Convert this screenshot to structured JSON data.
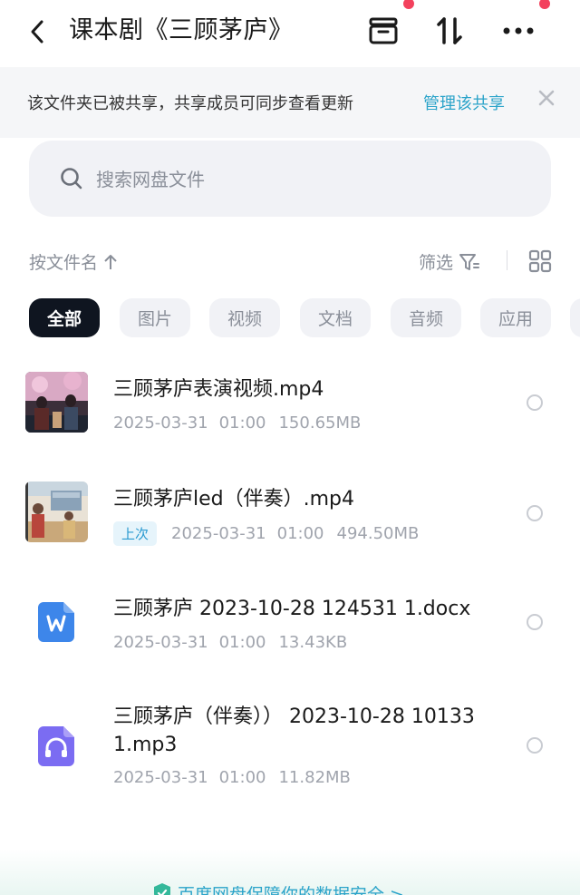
{
  "header": {
    "title": "课本剧《三顾茅庐》",
    "icons": [
      "back-icon",
      "archive-icon",
      "sort-icon",
      "more-icon"
    ]
  },
  "share_banner": {
    "text": "该文件夹已被共享，共享成员可同步查看更新",
    "link": "管理该共享"
  },
  "search": {
    "placeholder": "搜索网盘文件"
  },
  "toolbar": {
    "sort_label": "按文件名",
    "filter_label": "筛选"
  },
  "chips": [
    "全部",
    "图片",
    "视频",
    "文档",
    "音频",
    "应用"
  ],
  "files": [
    {
      "name": "三顾茅庐表演视频.mp4",
      "date": "2025-03-31",
      "time": "01:00",
      "size": "150.65MB",
      "badge": "",
      "type": "video-thumbnail"
    },
    {
      "name": "三顾茅庐led（伴奏）.mp4",
      "date": "2025-03-31",
      "time": "01:00",
      "size": "494.50MB",
      "badge": "上次",
      "type": "video-thumbnail"
    },
    {
      "name": "三顾茅庐 2023-10-28 124531 1.docx",
      "date": "2025-03-31",
      "time": "01:00",
      "size": "13.43KB",
      "badge": "",
      "type": "word-doc-icon"
    },
    {
      "name": "三顾茅庐（伴奏）） 2023-10-28 10133 1.mp3",
      "date": "2025-03-31",
      "time": "01:00",
      "size": "11.82MB",
      "badge": "",
      "type": "audio-file-icon"
    }
  ],
  "footer": {
    "text": "百度网盘保障你的数据安全 >"
  },
  "colors": {
    "accent": "#2aa3c9",
    "chip_active_bg": "#0f1520",
    "notification_dot": "#f3415d",
    "word_blue": "#3d86ea",
    "audio_purple": "#7b6cf2"
  }
}
